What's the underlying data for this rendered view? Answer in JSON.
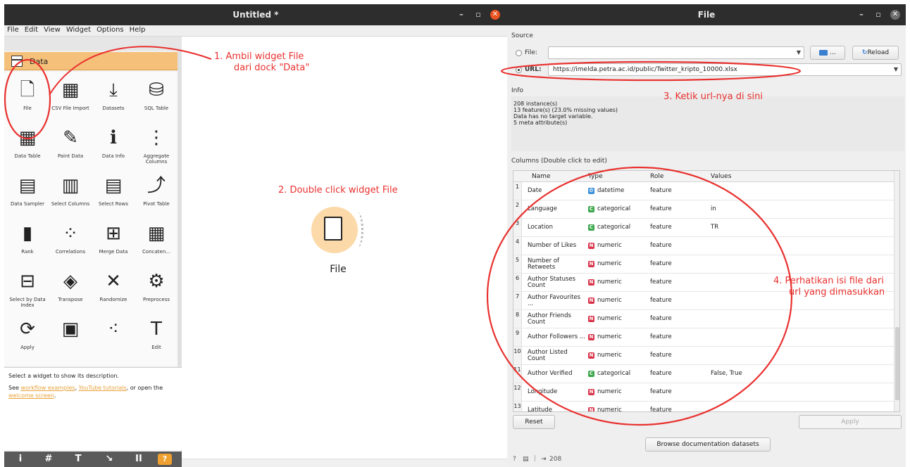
{
  "left_window": {
    "title": "Untitled *",
    "menu": [
      "File",
      "Edit",
      "View",
      "Widget",
      "Options",
      "Help"
    ],
    "dock": {
      "category": "Data",
      "widgets": [
        {
          "label": "File",
          "icon": "document-icon"
        },
        {
          "label": "CSV File Import",
          "icon": "csv-icon"
        },
        {
          "label": "Datasets",
          "icon": "download-icon"
        },
        {
          "label": "SQL Table",
          "icon": "database-icon"
        },
        {
          "label": "Data Table",
          "icon": "table-icon"
        },
        {
          "label": "Paint Data",
          "icon": "paint-icon"
        },
        {
          "label": "Data Info",
          "icon": "info-icon"
        },
        {
          "label": "Aggregate Columns",
          "icon": "aggregate-icon"
        },
        {
          "label": "Data Sampler",
          "icon": "sampler-icon"
        },
        {
          "label": "Select Columns",
          "icon": "select-columns-icon"
        },
        {
          "label": "Select Rows",
          "icon": "select-rows-icon"
        },
        {
          "label": "Pivot Table",
          "icon": "pivot-icon"
        },
        {
          "label": "Rank",
          "icon": "rank-icon"
        },
        {
          "label": "Correlations",
          "icon": "correlations-icon"
        },
        {
          "label": "Merge Data",
          "icon": "merge-icon"
        },
        {
          "label": "Concaten...",
          "icon": "concatenate-icon"
        },
        {
          "label": "Select by Data Index",
          "icon": "select-index-icon"
        },
        {
          "label": "Transpose",
          "icon": "transpose-icon"
        },
        {
          "label": "Randomize",
          "icon": "randomize-icon"
        },
        {
          "label": "Preprocess",
          "icon": "preprocess-icon"
        },
        {
          "label": "Apply",
          "icon": "apply-icon"
        },
        {
          "label": "",
          "icon": "grid-icon"
        },
        {
          "label": "",
          "icon": "scatter-icon"
        },
        {
          "label": "Edit",
          "icon": "edit-text-icon"
        }
      ]
    },
    "description": {
      "line1": "Select a widget to show its description.",
      "see": "See ",
      "link_workflow": "workflow examples",
      "comma": ", ",
      "link_youtube": "YouTube tutorials",
      "or": ", or open the ",
      "link_welcome": "welcome screen",
      "end": "."
    },
    "toolbar": [
      "i",
      "#",
      "T",
      "↘",
      "II",
      "?"
    ],
    "canvas_node": {
      "label": "File",
      "icon": "document-icon"
    }
  },
  "right_window": {
    "title": "File",
    "source_label": "Source",
    "file_label": "File:",
    "file_value": "",
    "browse_icon": "folder-icon",
    "browse_label": "...",
    "reload_label": "Reload",
    "url_label": "URL:",
    "url_value": "https://imelda.petra.ac.id/public/Twitter_kripto_10000.xlsx",
    "info_label": "Info",
    "info_lines": [
      "208 instance(s)",
      "13 feature(s) (23.0% missing values)",
      "Data has no target variable.",
      "5 meta attribute(s)"
    ],
    "columns_label": "Columns (Double click to edit)",
    "table_headers": [
      "Name",
      "Type",
      "Role",
      "Values"
    ],
    "rows": [
      {
        "idx": "1",
        "name": "Date",
        "type": "datetime",
        "kind": "t",
        "role": "feature",
        "values": ""
      },
      {
        "idx": "2",
        "name": "Language",
        "type": "categorical",
        "kind": "c",
        "role": "feature",
        "values": "in"
      },
      {
        "idx": "3",
        "name": "Location",
        "type": "categorical",
        "kind": "c",
        "role": "feature",
        "values": "TR"
      },
      {
        "idx": "4",
        "name": "Number of Likes",
        "type": "numeric",
        "kind": "n",
        "role": "feature",
        "values": ""
      },
      {
        "idx": "5",
        "name": "Number of Retweets",
        "type": "numeric",
        "kind": "n",
        "role": "feature",
        "values": ""
      },
      {
        "idx": "6",
        "name": "Author Statuses Count",
        "type": "numeric",
        "kind": "n",
        "role": "feature",
        "values": ""
      },
      {
        "idx": "7",
        "name": "Author Favourites ...",
        "type": "numeric",
        "kind": "n",
        "role": "feature",
        "values": ""
      },
      {
        "idx": "8",
        "name": "Author Friends Count",
        "type": "numeric",
        "kind": "n",
        "role": "feature",
        "values": ""
      },
      {
        "idx": "9",
        "name": "Author Followers ...",
        "type": "numeric",
        "kind": "n",
        "role": "feature",
        "values": ""
      },
      {
        "idx": "10",
        "name": "Author Listed Count",
        "type": "numeric",
        "kind": "n",
        "role": "feature",
        "values": ""
      },
      {
        "idx": "11",
        "name": "Author Verified",
        "type": "categorical",
        "kind": "c",
        "role": "feature",
        "values": "False, True"
      },
      {
        "idx": "12",
        "name": "Longitude",
        "type": "numeric",
        "kind": "n",
        "role": "feature",
        "values": ""
      },
      {
        "idx": "13",
        "name": "Latitude",
        "type": "numeric",
        "kind": "n",
        "role": "feature",
        "values": ""
      }
    ],
    "reset_label": "Reset",
    "apply_label": "Apply",
    "browse_docs_label": "Browse documentation datasets",
    "status_count": "208"
  },
  "annotations": {
    "step1": "1. Ambil widget File\ndari dock \"Data\"",
    "step2": "2. Double click widget File",
    "step3": "3. Ketik url-nya di sini",
    "step4": "4. Perhatikan isi file dari\nurl yang dimasukkan"
  },
  "colors": {
    "titlebar": "#2d2d2d",
    "data_category": "#f5c07a",
    "node": "#fcd9a8",
    "annotation": "#e8312f",
    "categorical": "#3aa64b",
    "numeric": "#d9334a",
    "datetime": "#3a8fd9",
    "link": "#e8a23a"
  }
}
